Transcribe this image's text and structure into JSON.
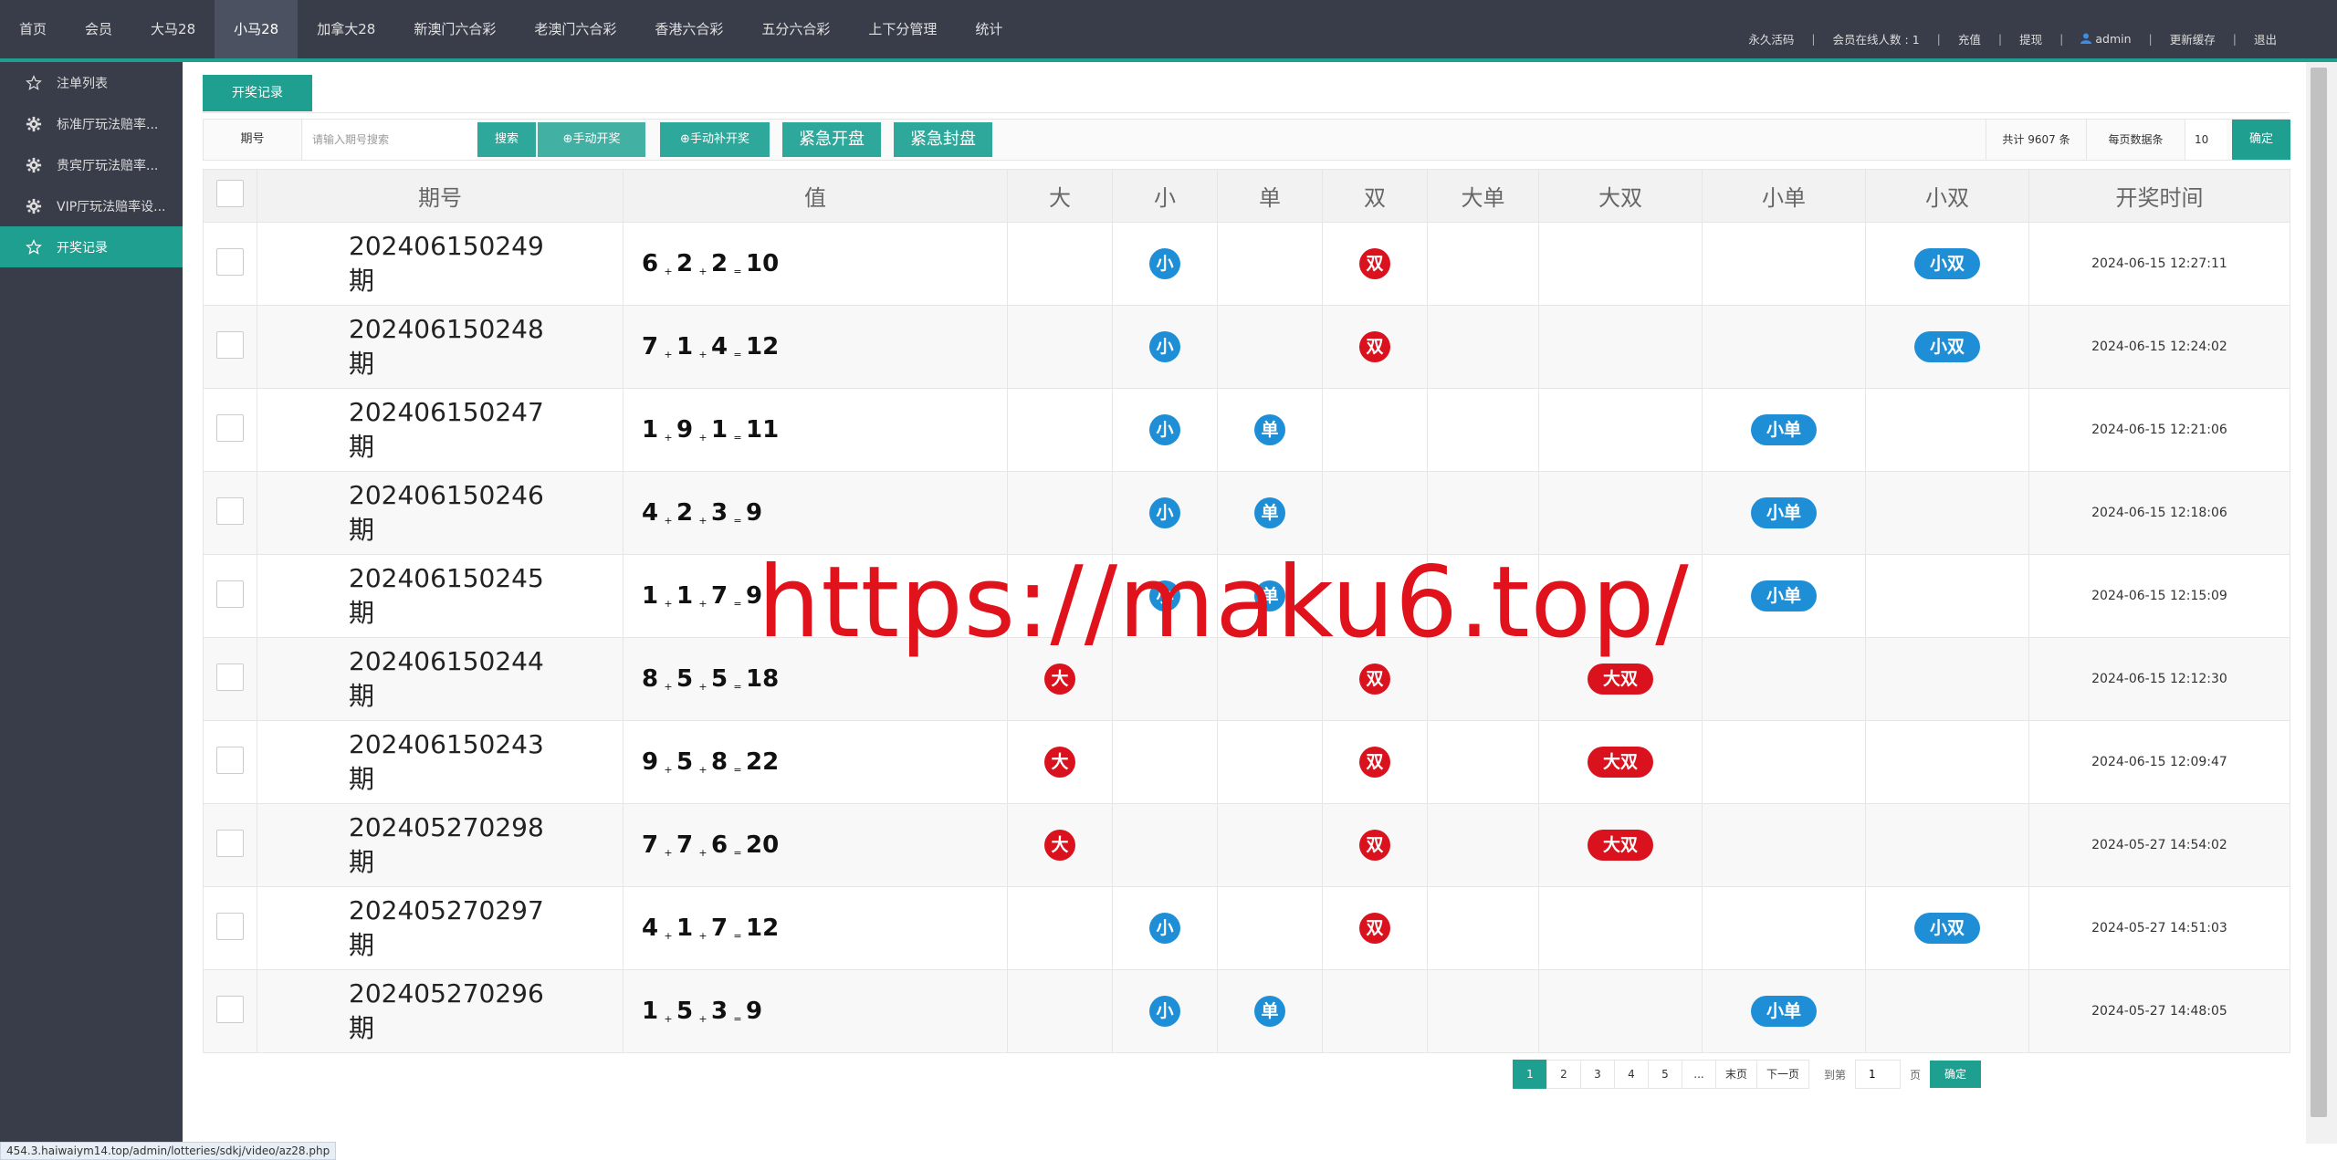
{
  "topnav": {
    "items": [
      "首页",
      "会员",
      "大马28",
      "小马28",
      "加拿大28",
      "新澳门六合彩",
      "老澳门六合彩",
      "香港六合彩",
      "五分六合彩",
      "上下分管理",
      "统计"
    ],
    "active_index": 3
  },
  "userbar": {
    "permanent_code": "永久活码",
    "online_label": "会员在线人数 :",
    "online_count": "1",
    "recharge": "充值",
    "withdraw": "提现",
    "username": "admin",
    "update_cache": "更新缓存",
    "logout": "退出"
  },
  "sidebar": {
    "items": [
      {
        "label": "注单列表",
        "icon": "star-icon"
      },
      {
        "label": "标准厅玩法赔率...",
        "icon": "gear-icon"
      },
      {
        "label": "贵宾厅玩法赔率...",
        "icon": "gear-icon"
      },
      {
        "label": "VIP厅玩法赔率设...",
        "icon": "gear-icon"
      },
      {
        "label": "开奖记录",
        "icon": "star-icon"
      }
    ],
    "active_index": 4
  },
  "tab": {
    "label": "开奖记录"
  },
  "toolbar": {
    "period_label": "期号",
    "search_placeholder": "请输入期号搜索",
    "search_btn": "搜索",
    "manual_draw": "手动开奖",
    "manual_supplement": "手动补开奖",
    "emergency_open": "紧急开盘",
    "emergency_close": "紧急封盘",
    "total": "共计 9607 条",
    "per_page_label": "每页数据条",
    "per_page_value": "10",
    "confirm": "确定"
  },
  "table": {
    "headers": [
      "期号",
      "值",
      "大",
      "小",
      "单",
      "双",
      "大单",
      "大双",
      "小单",
      "小双",
      "开奖时间"
    ],
    "period_suffix": "期",
    "rows": [
      {
        "period": "202406150249",
        "nums": [
          "6",
          "2",
          "2"
        ],
        "sum": "10",
        "da": "",
        "xiao": "小",
        "dan": "",
        "shuang": "双",
        "dadan": "",
        "dashuang": "",
        "xiaodan": "",
        "xiaoshuang": "小双",
        "time": "2024-06-15 12:27:11"
      },
      {
        "period": "202406150248",
        "nums": [
          "7",
          "1",
          "4"
        ],
        "sum": "12",
        "da": "",
        "xiao": "小",
        "dan": "",
        "shuang": "双",
        "dadan": "",
        "dashuang": "",
        "xiaodan": "",
        "xiaoshuang": "小双",
        "time": "2024-06-15 12:24:02"
      },
      {
        "period": "202406150247",
        "nums": [
          "1",
          "9",
          "1"
        ],
        "sum": "11",
        "da": "",
        "xiao": "小",
        "dan": "单",
        "shuang": "",
        "dadan": "",
        "dashuang": "",
        "xiaodan": "小单",
        "xiaoshuang": "",
        "time": "2024-06-15 12:21:06"
      },
      {
        "period": "202406150246",
        "nums": [
          "4",
          "2",
          "3"
        ],
        "sum": "9",
        "da": "",
        "xiao": "小",
        "dan": "单",
        "shuang": "",
        "dadan": "",
        "dashuang": "",
        "xiaodan": "小单",
        "xiaoshuang": "",
        "time": "2024-06-15 12:18:06"
      },
      {
        "period": "202406150245",
        "nums": [
          "1",
          "1",
          "7"
        ],
        "sum": "9",
        "da": "",
        "xiao": "小",
        "dan": "单",
        "shuang": "",
        "dadan": "",
        "dashuang": "",
        "xiaodan": "小单",
        "xiaoshuang": "",
        "time": "2024-06-15 12:15:09"
      },
      {
        "period": "202406150244",
        "nums": [
          "8",
          "5",
          "5"
        ],
        "sum": "18",
        "da": "大",
        "xiao": "",
        "dan": "",
        "shuang": "双",
        "dadan": "",
        "dashuang": "大双",
        "xiaodan": "",
        "xiaoshuang": "",
        "time": "2024-06-15 12:12:30"
      },
      {
        "period": "202406150243",
        "nums": [
          "9",
          "5",
          "8"
        ],
        "sum": "22",
        "da": "大",
        "xiao": "",
        "dan": "",
        "shuang": "双",
        "dadan": "",
        "dashuang": "大双",
        "xiaodan": "",
        "xiaoshuang": "",
        "time": "2024-06-15 12:09:47"
      },
      {
        "period": "202405270298",
        "nums": [
          "7",
          "7",
          "6"
        ],
        "sum": "20",
        "da": "大",
        "xiao": "",
        "dan": "",
        "shuang": "双",
        "dadan": "",
        "dashuang": "大双",
        "xiaodan": "",
        "xiaoshuang": "",
        "time": "2024-05-27 14:54:02"
      },
      {
        "period": "202405270297",
        "nums": [
          "4",
          "1",
          "7"
        ],
        "sum": "12",
        "da": "",
        "xiao": "小",
        "dan": "",
        "shuang": "双",
        "dadan": "",
        "dashuang": "",
        "xiaodan": "",
        "xiaoshuang": "小双",
        "time": "2024-05-27 14:51:03"
      },
      {
        "period": "202405270296",
        "nums": [
          "1",
          "5",
          "3"
        ],
        "sum": "9",
        "da": "",
        "xiao": "小",
        "dan": "单",
        "shuang": "",
        "dadan": "",
        "dashuang": "",
        "xiaodan": "小单",
        "xiaoshuang": "",
        "time": "2024-05-27 14:48:05"
      }
    ]
  },
  "pager": {
    "pages": [
      "1",
      "2",
      "3",
      "4",
      "5",
      "...",
      "末页",
      "下一页"
    ],
    "current": "1",
    "goto_label": "到第",
    "goto_value": "1",
    "unit": "页",
    "go": "确定"
  },
  "watermark": "https://maku6.top/",
  "statusbar": "454.3.haiwaiym14.top/admin/lotteries/sdkj/video/az28.php",
  "colors": {
    "nav_bg": "#393d49",
    "accent": "#1e9f8f",
    "ball_blue": "#1e8fd6",
    "ball_red": "#d9121d"
  }
}
